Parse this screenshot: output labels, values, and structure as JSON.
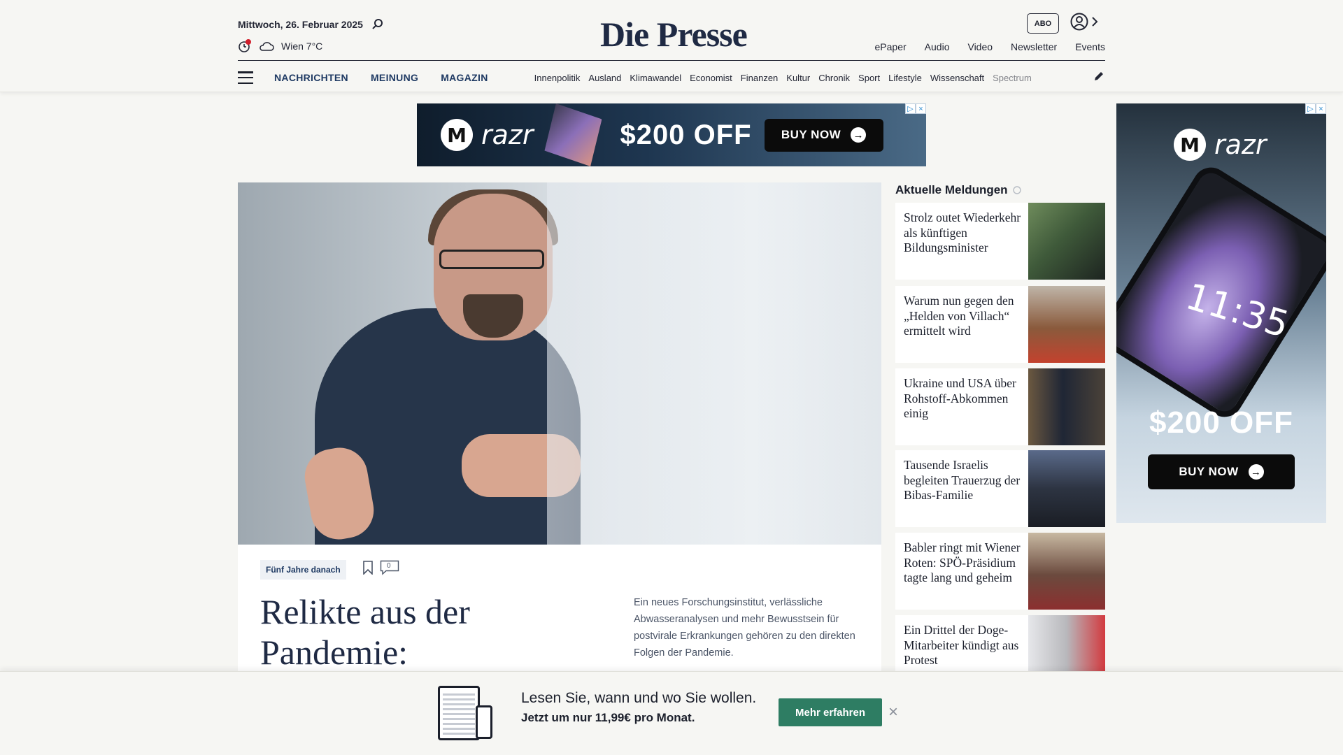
{
  "header": {
    "date": "Mittwoch, 26. Februar 2025",
    "weather": "Wien 7°C",
    "logo": "Die Presse",
    "abo": "ABO",
    "top_links": [
      "ePaper",
      "Audio",
      "Video",
      "Newsletter",
      "Events"
    ],
    "main_nav": [
      "NACHRICHTEN",
      "MEINUNG",
      "MAGAZIN"
    ],
    "sections": [
      "Innenpolitik",
      "Ausland",
      "Klimawandel",
      "Economist",
      "Finanzen",
      "Kultur",
      "Chronik",
      "Sport",
      "Lifestyle",
      "Wissenschaft",
      "Spectrum"
    ]
  },
  "ad_top": {
    "brand": "razr",
    "price": "$200 OFF",
    "cta": "BUY NOW"
  },
  "ad_side": {
    "brand": "razr",
    "phone_time": "11:35",
    "price": "$200 OFF",
    "cta": "BUY NOW"
  },
  "article": {
    "tag": "Fünf Jahre danach",
    "comments": "0",
    "headline": "Relikte aus der Pandemie:",
    "teaser": "Ein neues Forschungsinstitut, verlässliche Abwasseranalysen und mehr Bewusstsein für postvirale Erkrankungen gehören zu den direkten Folgen der Pandemie."
  },
  "sidebar": {
    "title": "Aktuelle Meldungen",
    "items": [
      {
        "text": "Strolz outet Wiederkehr als künftigen Bildungsminister",
        "thumb_color": "#3f5a3a"
      },
      {
        "text": "Warum nun gegen den „Helden von Villach“ ermittelt wird",
        "thumb_color": "#8a5a3c"
      },
      {
        "text": "Ukraine und USA über Rohstoff-Abkommen einig",
        "thumb_color": "#4b4238"
      },
      {
        "text": "Tausende Israelis begleiten Trauerzug der Bibas-Familie",
        "thumb_color": "#2d3442"
      },
      {
        "text": "Babler ringt mit Wiener Roten: SPÖ-Präsidium tagte lang und geheim",
        "thumb_color": "#6b4a3e"
      },
      {
        "text": "Ein Drittel der Doge-Mitarbeiter kündigt aus Protest",
        "thumb_color": "#b8b8bc"
      }
    ]
  },
  "promo": {
    "title": "Lesen Sie, wann und wo Sie wollen.",
    "subtitle": "Jetzt um nur 11,99€ pro Monat.",
    "button": "Mehr erfahren"
  },
  "colors": {
    "brand_navy": "#1f2a44",
    "nav_blue": "#1f3a63",
    "promo_green": "#2e7d63"
  }
}
